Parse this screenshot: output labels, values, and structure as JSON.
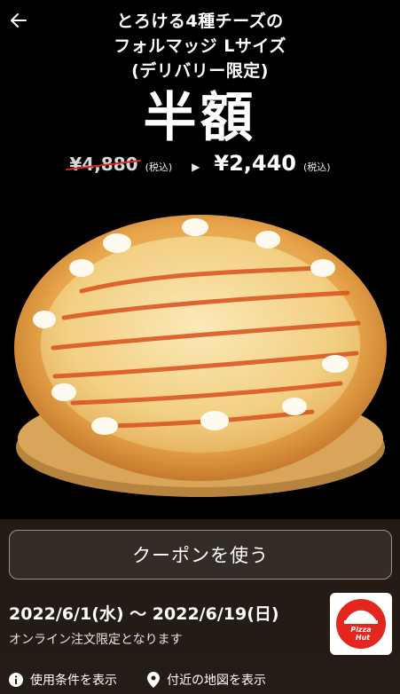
{
  "header": {
    "back_icon": "arrow-left-icon",
    "title_lines": [
      "とろける4種チーズの",
      "フォルマッジ Lサイズ",
      "(デリバリー限定)"
    ]
  },
  "promo": {
    "headline": "半額",
    "old_price": "¥4,880",
    "old_tax": "(税込)",
    "arrow": "▶",
    "new_price": "¥2,440",
    "new_tax": "(税込)"
  },
  "coupon": {
    "button_label": "クーポンを使う"
  },
  "details": {
    "period": "2022/6/1(水) 〜 2022/6/19(日)",
    "note": "オンライン注文限定となります"
  },
  "brand": {
    "logo_icon": "pizza-hut-logo",
    "logo_text": "Pizza Hut",
    "color": "#e3261e"
  },
  "footer": {
    "terms_label": "使用条件を表示",
    "terms_icon": "info-icon",
    "map_label": "付近の地図を表示",
    "map_icon": "map-pin-icon"
  }
}
